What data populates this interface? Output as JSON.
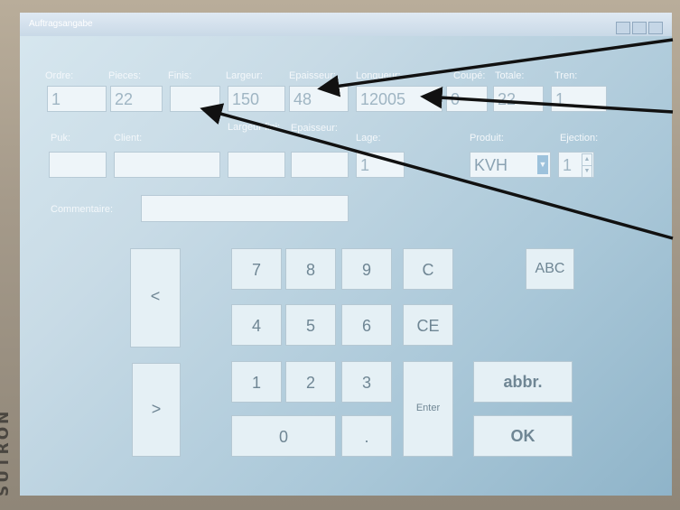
{
  "device": {
    "brand": "SUTRON"
  },
  "window": {
    "title": "Auftragsangabe"
  },
  "row1": {
    "labels": [
      "Ordre:",
      "Pieces:",
      "Finis:",
      "Largeur:",
      "Epaisseur:",
      "Longueur:",
      "Coupé:",
      "Totale:",
      "Tren:"
    ],
    "values": [
      "1",
      "22",
      "",
      "150",
      "48",
      "12005",
      "0",
      "22",
      "1"
    ]
  },
  "row2": {
    "labels": [
      "Puk:",
      "Client:",
      "Largeur fini:",
      "Epaisseur:",
      "Lage:",
      "Produit:",
      "Ejection:"
    ],
    "values": [
      "",
      "",
      "",
      "",
      "1",
      "KVH",
      "1"
    ]
  },
  "comment": {
    "label": "Commentaire:",
    "value": ""
  },
  "keypad": {
    "prev": "<",
    "next": ">",
    "k7": "7",
    "k8": "8",
    "k9": "9",
    "clear": "C",
    "k4": "4",
    "k5": "5",
    "k6": "6",
    "clear_entry": "CE",
    "k1": "1",
    "k2": "2",
    "k3": "3",
    "enter": "Enter",
    "k0": "0",
    "dot": ".",
    "abc": "ABC",
    "abbr": "abbr.",
    "ok": "OK"
  },
  "colors": {
    "screen": "#c8dbe6",
    "field": "#eef5f9",
    "key": "#e5f0f5",
    "arrow": "#111111"
  }
}
